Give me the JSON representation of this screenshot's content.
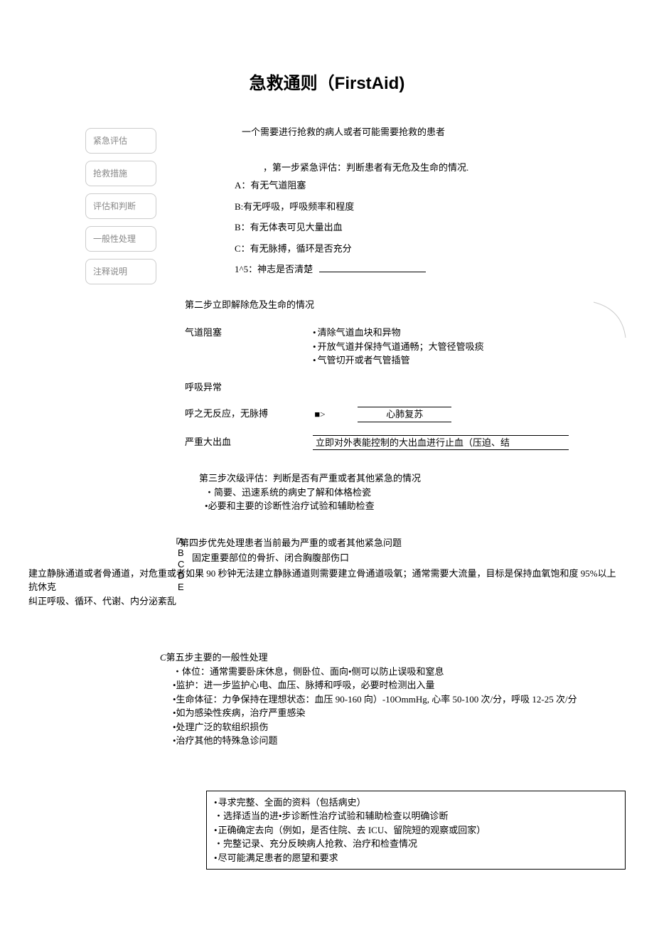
{
  "title_cn": "急救通则（",
  "title_en": "FirstAid",
  "title_close": ")",
  "sidebar": {
    "items": [
      {
        "label": "紧急评估"
      },
      {
        "label": "抢救措施"
      },
      {
        "label": "评估和判断"
      },
      {
        "label": "一般性处理"
      },
      {
        "label": "注释说明"
      }
    ]
  },
  "intro_line": "一个需要进行抢救的病人或者可能需要抢救的患者",
  "step1": {
    "title": "，第一步紧急评估：判断患者有无危及生命的情况.",
    "items": [
      "A：有无气道阻塞",
      "B:有无呼吸，呼吸频率和程度",
      "B：有无体表可见大量出血",
      "C：有无脉搏，循环是否充分",
      "1^5：神志是否清楚"
    ]
  },
  "step2": {
    "title": "第二步立即解除危及生命的情况",
    "rows": [
      {
        "left": "气道阻塞",
        "right": [
          "清除气道血块和异物",
          "开放气道并保持气道通畅；大管径管吸痰",
          "气管切开或者气管插管"
        ]
      },
      {
        "left": "呼吸异常",
        "right": []
      },
      {
        "left": "呼之无反应，无脉搏",
        "arrow": "■>",
        "cpr": "心肺复苏"
      },
      {
        "left": "严重大出血",
        "bleeding": "立即对外表能控制的大出血进行止血（压迫、结"
      }
    ]
  },
  "step3": {
    "title": "第三步次级评估：判断是否有严重或者其他紧急的情况",
    "bullets": [
      "简要、迅速系统的病史了解和体格检瓷",
      "必要和主要的诊断性治疗试验和辅助检查"
    ]
  },
  "step4": {
    "letters": [
      "A",
      "B",
      "C",
      "D",
      "E"
    ],
    "title": "「第四步优先处理患者当前最为严重的或者其他紧急问题",
    "line1": "固定重要部位的骨折、闭合胸腹部伤口",
    "long1": "建立静脉通道或者骨通道，对危重或者如果 90 秒钟无法建立静脉通道则需要建立骨通道吸氧；通常需要大流量，目标是保持血氧饱和度 95%以上",
    "long2": "抗休克",
    "long3": "纠正呼吸、循环、代谢、内分泌紊乱"
  },
  "step5": {
    "prefix": "C",
    "title": "第五步主要的一般性处理",
    "items": [
      "・体位：通常需要卧床休息，侧卧位、面向•侧可以防止误吸和窒息",
      "•监护：进一步监护心电、血压、脉搏和呼吸，必要时检测出入量",
      "•生命体征：力争保持在理想状态：血压 90-160 向）-10OmmHg, 心率 50-100 次/分，呼吸 12-25 次/分",
      "•如为感染性疾病，治疗严重感染",
      "•处理广泛的软组织损伤",
      "•治疗其他的特殊急诊问题"
    ]
  },
  "bottom_box": {
    "items": [
      "寻求完整、全面的资料（包括病史）",
      "・选择适当的进•步诊断性治疗试验和辅助检查以明确诊断",
      "正确确定去向（例如，是否住院、去 ICU、留院短的观察或回家）",
      "・完整记录、充分反映病人抢救、治疗和检查情况",
      "尽可能满足患者的愿望和要求"
    ]
  }
}
